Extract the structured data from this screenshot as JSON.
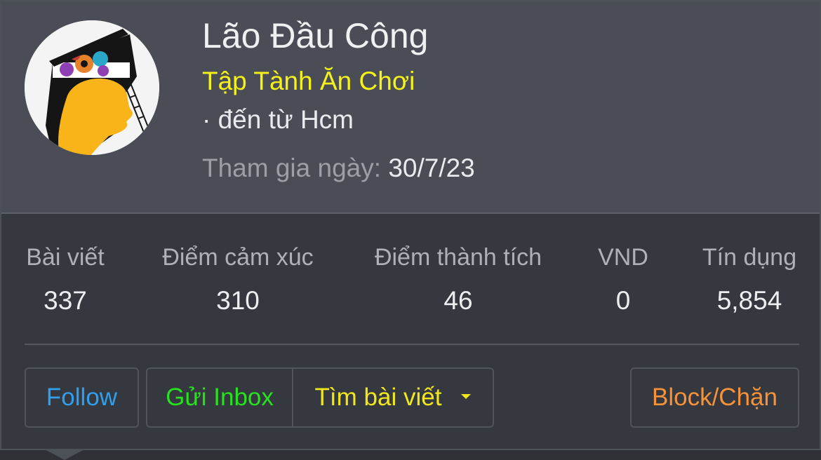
{
  "profile": {
    "name": "Lão Đầu Công",
    "user_title": "Tập Tành Ăn Chơi",
    "location": "· đến từ Hcm",
    "join_label": "Tham gia ngày: ",
    "join_date": "30/7/23"
  },
  "stats": [
    {
      "label": "Bài viết",
      "value": "337"
    },
    {
      "label": "Điểm cảm xúc",
      "value": "310"
    },
    {
      "label": "Điểm thành tích",
      "value": "46"
    },
    {
      "label": "VND",
      "value": "0"
    },
    {
      "label": "Tín dụng",
      "value": "5,854"
    }
  ],
  "actions": {
    "follow": "Follow",
    "inbox": "Gửi Inbox",
    "find_posts": "Tìm bài viết",
    "block": "Block/Chặn"
  },
  "colors": {
    "follow": "#2f9ff0",
    "inbox": "#27e21f",
    "find_posts": "#f0e81c",
    "block": "#f5923a",
    "user_title": "#f5f21a"
  }
}
